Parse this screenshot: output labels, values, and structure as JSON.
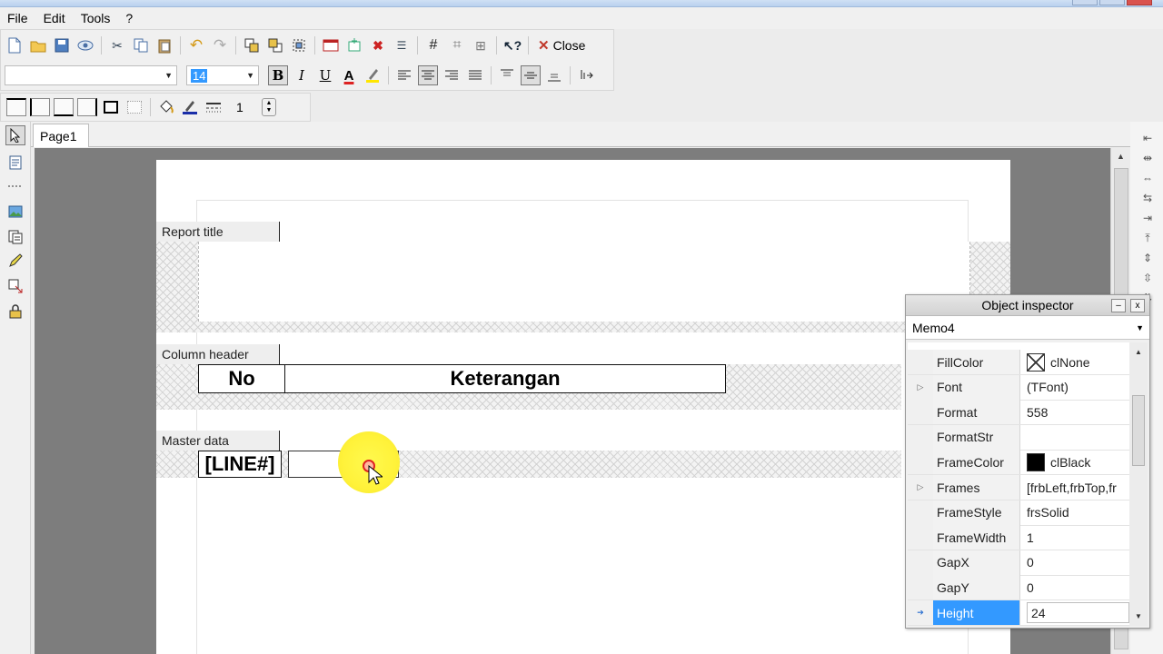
{
  "menu": [
    "File",
    "Edit",
    "Tools",
    "?"
  ],
  "toolbar": {
    "close_label": "Close",
    "font_name": "",
    "font_size": "14",
    "frame_width": "1"
  },
  "tabs": [
    "Page1"
  ],
  "report": {
    "bands": [
      {
        "label": "Report title"
      },
      {
        "label": "Column header"
      },
      {
        "label": "Master data"
      }
    ],
    "memos": {
      "no": "No",
      "keterangan": "Keterangan",
      "line": "[LINE#]",
      "empty": ""
    }
  },
  "inspector": {
    "title": "Object inspector",
    "object": "Memo4",
    "selected_property": "Height",
    "properties": [
      {
        "name": "FillColor",
        "value": "clNone",
        "swatch": "none",
        "expandable": false
      },
      {
        "name": "Font",
        "value": "(TFont)",
        "swatch": "",
        "expandable": true
      },
      {
        "name": "Format",
        "value": "558",
        "swatch": "",
        "expandable": false
      },
      {
        "name": "FormatStr",
        "value": "",
        "swatch": "",
        "expandable": false
      },
      {
        "name": "FrameColor",
        "value": "clBlack",
        "swatch": "black",
        "expandable": false
      },
      {
        "name": "Frames",
        "value": "[frbLeft,frbTop,fr",
        "swatch": "",
        "expandable": true
      },
      {
        "name": "FrameStyle",
        "value": "frsSolid",
        "swatch": "",
        "expandable": false
      },
      {
        "name": "FrameWidth",
        "value": "1",
        "swatch": "",
        "expandable": false
      },
      {
        "name": "GapX",
        "value": "0",
        "swatch": "",
        "expandable": false
      },
      {
        "name": "GapY",
        "value": "0",
        "swatch": "",
        "expandable": false
      },
      {
        "name": "Height",
        "value": "24",
        "swatch": "",
        "expandable": false
      }
    ]
  },
  "colors": {
    "selection": "#3399ff",
    "cursor_highlight": "#fff23a",
    "canvas": "#7d7d7d"
  }
}
